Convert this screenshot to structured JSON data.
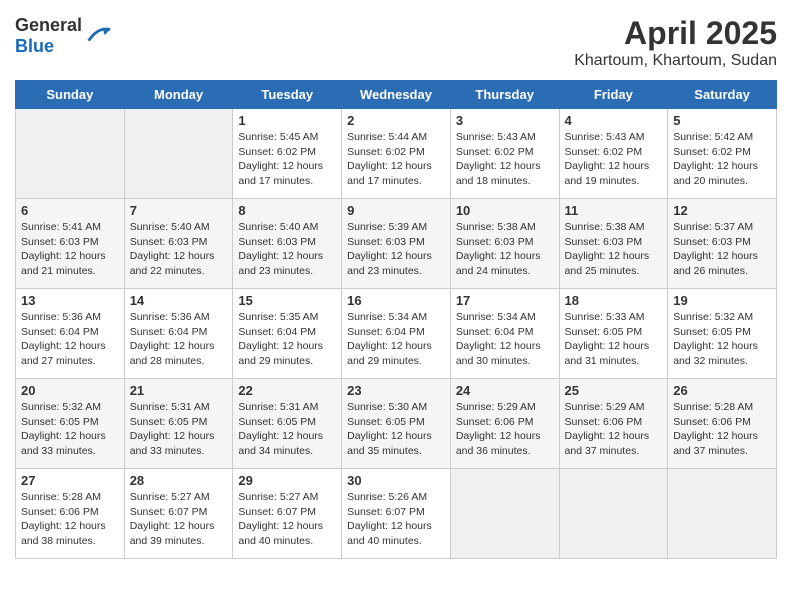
{
  "header": {
    "logo_general": "General",
    "logo_blue": "Blue",
    "title": "April 2025",
    "subtitle": "Khartoum, Khartoum, Sudan"
  },
  "weekdays": [
    "Sunday",
    "Monday",
    "Tuesday",
    "Wednesday",
    "Thursday",
    "Friday",
    "Saturday"
  ],
  "weeks": [
    [
      {
        "day": "",
        "sunrise": "",
        "sunset": "",
        "daylight": ""
      },
      {
        "day": "",
        "sunrise": "",
        "sunset": "",
        "daylight": ""
      },
      {
        "day": "1",
        "sunrise": "Sunrise: 5:45 AM",
        "sunset": "Sunset: 6:02 PM",
        "daylight": "Daylight: 12 hours and 17 minutes."
      },
      {
        "day": "2",
        "sunrise": "Sunrise: 5:44 AM",
        "sunset": "Sunset: 6:02 PM",
        "daylight": "Daylight: 12 hours and 17 minutes."
      },
      {
        "day": "3",
        "sunrise": "Sunrise: 5:43 AM",
        "sunset": "Sunset: 6:02 PM",
        "daylight": "Daylight: 12 hours and 18 minutes."
      },
      {
        "day": "4",
        "sunrise": "Sunrise: 5:43 AM",
        "sunset": "Sunset: 6:02 PM",
        "daylight": "Daylight: 12 hours and 19 minutes."
      },
      {
        "day": "5",
        "sunrise": "Sunrise: 5:42 AM",
        "sunset": "Sunset: 6:02 PM",
        "daylight": "Daylight: 12 hours and 20 minutes."
      }
    ],
    [
      {
        "day": "6",
        "sunrise": "Sunrise: 5:41 AM",
        "sunset": "Sunset: 6:03 PM",
        "daylight": "Daylight: 12 hours and 21 minutes."
      },
      {
        "day": "7",
        "sunrise": "Sunrise: 5:40 AM",
        "sunset": "Sunset: 6:03 PM",
        "daylight": "Daylight: 12 hours and 22 minutes."
      },
      {
        "day": "8",
        "sunrise": "Sunrise: 5:40 AM",
        "sunset": "Sunset: 6:03 PM",
        "daylight": "Daylight: 12 hours and 23 minutes."
      },
      {
        "day": "9",
        "sunrise": "Sunrise: 5:39 AM",
        "sunset": "Sunset: 6:03 PM",
        "daylight": "Daylight: 12 hours and 23 minutes."
      },
      {
        "day": "10",
        "sunrise": "Sunrise: 5:38 AM",
        "sunset": "Sunset: 6:03 PM",
        "daylight": "Daylight: 12 hours and 24 minutes."
      },
      {
        "day": "11",
        "sunrise": "Sunrise: 5:38 AM",
        "sunset": "Sunset: 6:03 PM",
        "daylight": "Daylight: 12 hours and 25 minutes."
      },
      {
        "day": "12",
        "sunrise": "Sunrise: 5:37 AM",
        "sunset": "Sunset: 6:03 PM",
        "daylight": "Daylight: 12 hours and 26 minutes."
      }
    ],
    [
      {
        "day": "13",
        "sunrise": "Sunrise: 5:36 AM",
        "sunset": "Sunset: 6:04 PM",
        "daylight": "Daylight: 12 hours and 27 minutes."
      },
      {
        "day": "14",
        "sunrise": "Sunrise: 5:36 AM",
        "sunset": "Sunset: 6:04 PM",
        "daylight": "Daylight: 12 hours and 28 minutes."
      },
      {
        "day": "15",
        "sunrise": "Sunrise: 5:35 AM",
        "sunset": "Sunset: 6:04 PM",
        "daylight": "Daylight: 12 hours and 29 minutes."
      },
      {
        "day": "16",
        "sunrise": "Sunrise: 5:34 AM",
        "sunset": "Sunset: 6:04 PM",
        "daylight": "Daylight: 12 hours and 29 minutes."
      },
      {
        "day": "17",
        "sunrise": "Sunrise: 5:34 AM",
        "sunset": "Sunset: 6:04 PM",
        "daylight": "Daylight: 12 hours and 30 minutes."
      },
      {
        "day": "18",
        "sunrise": "Sunrise: 5:33 AM",
        "sunset": "Sunset: 6:05 PM",
        "daylight": "Daylight: 12 hours and 31 minutes."
      },
      {
        "day": "19",
        "sunrise": "Sunrise: 5:32 AM",
        "sunset": "Sunset: 6:05 PM",
        "daylight": "Daylight: 12 hours and 32 minutes."
      }
    ],
    [
      {
        "day": "20",
        "sunrise": "Sunrise: 5:32 AM",
        "sunset": "Sunset: 6:05 PM",
        "daylight": "Daylight: 12 hours and 33 minutes."
      },
      {
        "day": "21",
        "sunrise": "Sunrise: 5:31 AM",
        "sunset": "Sunset: 6:05 PM",
        "daylight": "Daylight: 12 hours and 33 minutes."
      },
      {
        "day": "22",
        "sunrise": "Sunrise: 5:31 AM",
        "sunset": "Sunset: 6:05 PM",
        "daylight": "Daylight: 12 hours and 34 minutes."
      },
      {
        "day": "23",
        "sunrise": "Sunrise: 5:30 AM",
        "sunset": "Sunset: 6:05 PM",
        "daylight": "Daylight: 12 hours and 35 minutes."
      },
      {
        "day": "24",
        "sunrise": "Sunrise: 5:29 AM",
        "sunset": "Sunset: 6:06 PM",
        "daylight": "Daylight: 12 hours and 36 minutes."
      },
      {
        "day": "25",
        "sunrise": "Sunrise: 5:29 AM",
        "sunset": "Sunset: 6:06 PM",
        "daylight": "Daylight: 12 hours and 37 minutes."
      },
      {
        "day": "26",
        "sunrise": "Sunrise: 5:28 AM",
        "sunset": "Sunset: 6:06 PM",
        "daylight": "Daylight: 12 hours and 37 minutes."
      }
    ],
    [
      {
        "day": "27",
        "sunrise": "Sunrise: 5:28 AM",
        "sunset": "Sunset: 6:06 PM",
        "daylight": "Daylight: 12 hours and 38 minutes."
      },
      {
        "day": "28",
        "sunrise": "Sunrise: 5:27 AM",
        "sunset": "Sunset: 6:07 PM",
        "daylight": "Daylight: 12 hours and 39 minutes."
      },
      {
        "day": "29",
        "sunrise": "Sunrise: 5:27 AM",
        "sunset": "Sunset: 6:07 PM",
        "daylight": "Daylight: 12 hours and 40 minutes."
      },
      {
        "day": "30",
        "sunrise": "Sunrise: 5:26 AM",
        "sunset": "Sunset: 6:07 PM",
        "daylight": "Daylight: 12 hours and 40 minutes."
      },
      {
        "day": "",
        "sunrise": "",
        "sunset": "",
        "daylight": ""
      },
      {
        "day": "",
        "sunrise": "",
        "sunset": "",
        "daylight": ""
      },
      {
        "day": "",
        "sunrise": "",
        "sunset": "",
        "daylight": ""
      }
    ]
  ]
}
